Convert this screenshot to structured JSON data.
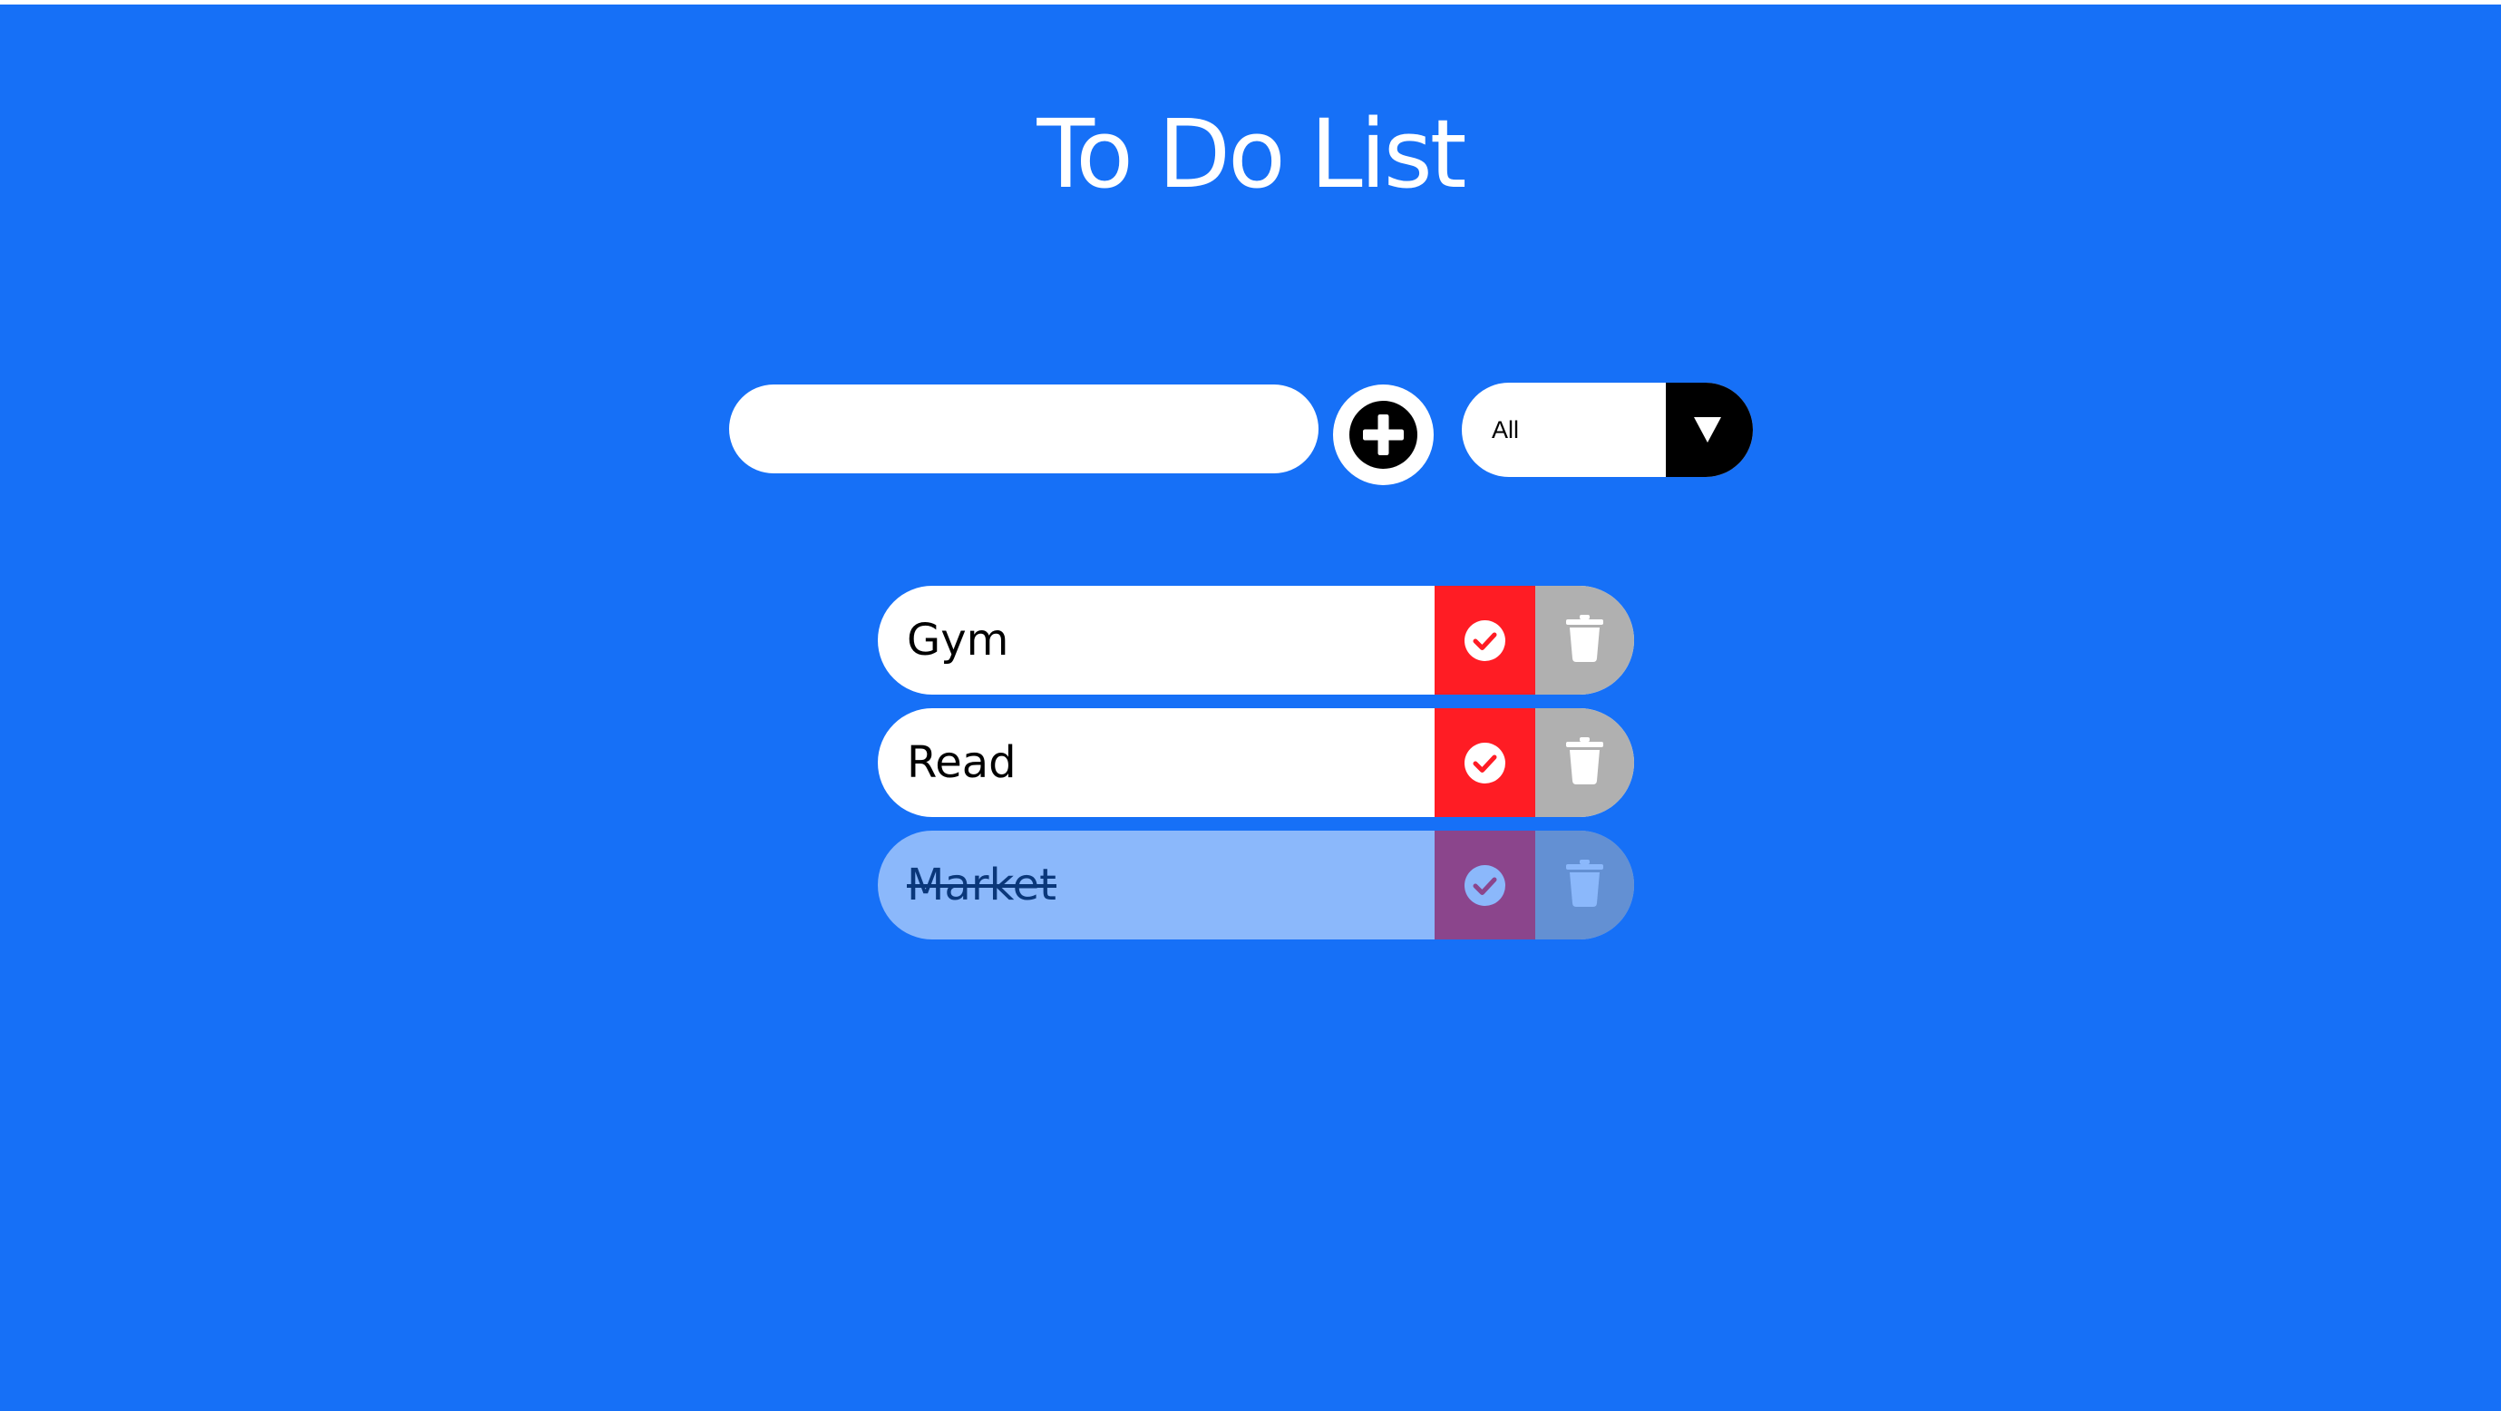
{
  "header": {
    "title": "To Do List"
  },
  "form": {
    "input_value": "",
    "input_placeholder": "",
    "add_icon": "plus-circle-icon",
    "filter": {
      "selected": "All",
      "arrow_icon": "triangle-down-icon"
    }
  },
  "todos": [
    {
      "text": "Gym",
      "completed": false
    },
    {
      "text": "Read",
      "completed": false
    },
    {
      "text": "Market",
      "completed": true
    }
  ],
  "icons": {
    "complete": "check-circle-icon",
    "delete": "trash-icon"
  },
  "colors": {
    "background": "#1670f7",
    "complete_button": "#ff1c24",
    "trash_button": "#b0b0b0",
    "filter_toggle": "#000000"
  }
}
